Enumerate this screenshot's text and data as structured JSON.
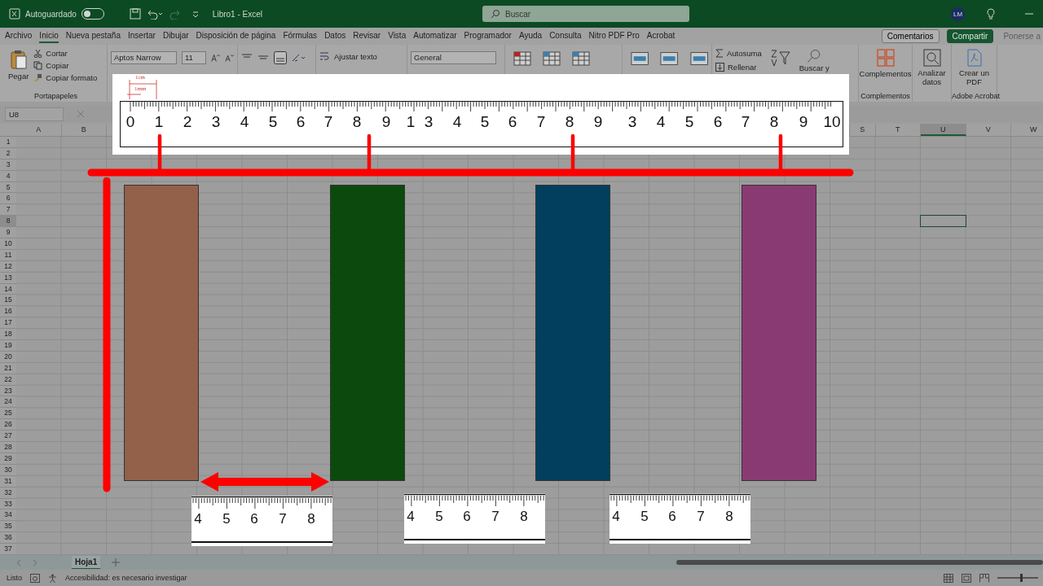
{
  "title_bar": {
    "autosave_label": "Autoguardado",
    "autosave_on": false,
    "document_title": "Libro1  -  Excel",
    "search_placeholder": "Buscar",
    "avatar": "LM"
  },
  "menu_tabs": [
    {
      "label": "Archivo",
      "selected": false
    },
    {
      "label": "Inicio",
      "selected": true
    },
    {
      "label": "Nueva pestaña",
      "selected": false
    },
    {
      "label": "Insertar",
      "selected": false
    },
    {
      "label": "Dibujar",
      "selected": false
    },
    {
      "label": "Disposición de página",
      "selected": false
    },
    {
      "label": "Fórmulas",
      "selected": false
    },
    {
      "label": "Datos",
      "selected": false
    },
    {
      "label": "Revisar",
      "selected": false
    },
    {
      "label": "Vista",
      "selected": false
    },
    {
      "label": "Automatizar",
      "selected": false
    },
    {
      "label": "Programador",
      "selected": false
    },
    {
      "label": "Ayuda",
      "selected": false
    },
    {
      "label": "Consulta",
      "selected": false
    },
    {
      "label": "Nitro PDF Pro",
      "selected": false
    },
    {
      "label": "Acrobat",
      "selected": false
    }
  ],
  "menu_actions": [
    {
      "label": "Comentarios",
      "kind": "outline"
    },
    {
      "label": "Compartir",
      "kind": "primary"
    },
    {
      "label": "Ponerse a",
      "kind": "disabled"
    }
  ],
  "ribbon": {
    "paste": "Pegar",
    "cut": "Cortar",
    "copy": "Copiar",
    "format_painter": "Copiar formato",
    "clipboard_group": "Portapapeles",
    "font_name": "Aptos Narrow",
    "font_size": "11",
    "wrap_text": "Ajustar texto",
    "number_format": "General",
    "autosum": "Autosuma",
    "fill": "Rellenar",
    "find_select": "Buscar y",
    "addins": "Complementos",
    "addins_group": "Complementos",
    "analyze": "Analizar datos",
    "create_pdf": "Crear un PDF",
    "acrobat_group": "Adobe Acrobat"
  },
  "formula_bar": {
    "name_box": "U8"
  },
  "sheet": {
    "columns": [
      {
        "label": "A",
        "selected": false
      },
      {
        "label": "B",
        "selected": false
      },
      {
        "label": "S",
        "selected": false
      },
      {
        "label": "T",
        "selected": false
      },
      {
        "label": "U",
        "selected": true
      },
      {
        "label": "V",
        "selected": false
      },
      {
        "label": "W",
        "selected": false
      }
    ],
    "rows": [
      {
        "label": "1",
        "selected": false
      },
      {
        "label": "2",
        "selected": false
      },
      {
        "label": "3",
        "selected": false
      },
      {
        "label": "4",
        "selected": false
      },
      {
        "label": "5",
        "selected": false
      },
      {
        "label": "6",
        "selected": false
      },
      {
        "label": "7",
        "selected": false
      },
      {
        "label": "8",
        "selected": true
      },
      {
        "label": "9",
        "selected": false
      },
      {
        "label": "10",
        "selected": false
      },
      {
        "label": "11",
        "selected": false
      },
      {
        "label": "12",
        "selected": false
      },
      {
        "label": "13",
        "selected": false
      },
      {
        "label": "14",
        "selected": false
      },
      {
        "label": "15",
        "selected": false
      },
      {
        "label": "16",
        "selected": false
      },
      {
        "label": "17",
        "selected": false
      },
      {
        "label": "18",
        "selected": false
      },
      {
        "label": "19",
        "selected": false
      },
      {
        "label": "20",
        "selected": false
      },
      {
        "label": "21",
        "selected": false
      },
      {
        "label": "22",
        "selected": false
      },
      {
        "label": "23",
        "selected": false
      },
      {
        "label": "24",
        "selected": false
      },
      {
        "label": "25",
        "selected": false
      },
      {
        "label": "26",
        "selected": false
      },
      {
        "label": "27",
        "selected": false
      },
      {
        "label": "28",
        "selected": false
      },
      {
        "label": "29",
        "selected": false
      },
      {
        "label": "30",
        "selected": false
      },
      {
        "label": "31",
        "selected": false
      },
      {
        "label": "32",
        "selected": false
      },
      {
        "label": "33",
        "selected": false
      },
      {
        "label": "34",
        "selected": false
      },
      {
        "label": "35",
        "selected": false
      },
      {
        "label": "36",
        "selected": false
      },
      {
        "label": "37",
        "selected": false
      }
    ]
  },
  "overlay": {
    "ruler": {
      "notes": [
        "1cm",
        "1mm"
      ],
      "numbers": [
        "0",
        "1",
        "2",
        "3",
        "4",
        "5",
        "6",
        "7",
        "8",
        "9",
        "1",
        "3",
        "4",
        "5",
        "6",
        "7",
        "8",
        "9",
        "3",
        "4",
        "5",
        "6",
        "7",
        "8",
        "9",
        "10"
      ]
    },
    "bars": [
      {
        "color": "#93604a"
      },
      {
        "color": "#0b4a0c"
      },
      {
        "color": "#023f5e"
      },
      {
        "color": "#8a3a73"
      }
    ],
    "small_rulers": [
      {
        "numbers": [
          "4",
          "5",
          "6",
          "7",
          "8"
        ]
      },
      {
        "numbers": [
          "4",
          "5",
          "6",
          "7",
          "8"
        ]
      },
      {
        "numbers": [
          "4",
          "5",
          "6",
          "7",
          "8"
        ]
      }
    ]
  },
  "sheet_tabs": [
    {
      "label": "Hoja1",
      "selected": true
    }
  ],
  "status_bar": {
    "ready": "Listo",
    "accessibility": "Accesibilidad: es necesario investigar",
    "zoom": {
      "level": 0.6
    }
  }
}
